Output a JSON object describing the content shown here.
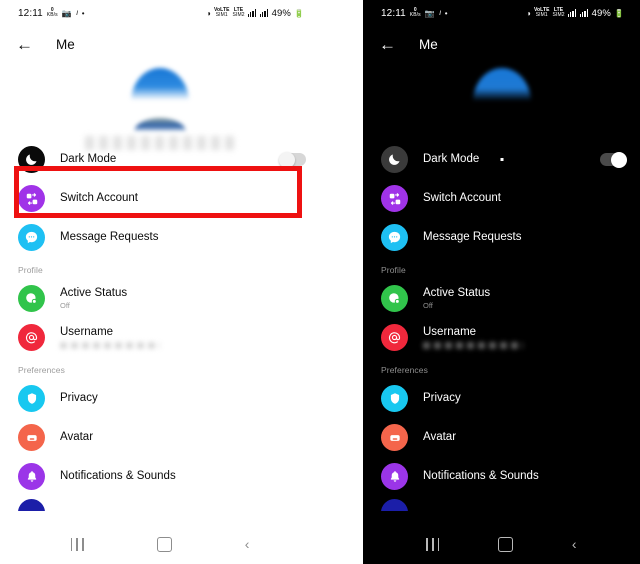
{
  "status_bar": {
    "time": "12:11",
    "left_icons": [
      "data-rate-icon",
      "image-icon",
      "messenger-m-icon",
      "dot-icon"
    ],
    "data_rate_value": "0",
    "data_rate_unit": "KB/s",
    "right_icons": [
      "nfc-icon",
      "volte-sim1-icon",
      "lte-sim2-icon",
      "signal-bars-1-icon",
      "signal-bars-2-icon"
    ],
    "sim1_label": "VoLTE",
    "sim1_sub": "SIM1",
    "sim2_label": "LTE",
    "sim2_sub": "SIM2",
    "battery_percent": "49%",
    "battery_icon": "battery-icon"
  },
  "app_bar": {
    "back_icon": "arrow-left-icon",
    "title": "Me"
  },
  "profile": {
    "avatar_icon": "avatar-blurred",
    "name_blurred": "••••••••••••"
  },
  "colors": {
    "highlight": "#ee1111",
    "dark_mode_icon_light": "#0a0a0a",
    "dark_mode_icon_dark": "#3a3a3a",
    "switch_account": "#a033e8",
    "message_requests": "#1ec0f3",
    "active_status": "#31c44b",
    "username": "#f0283c",
    "privacy": "#18c8f0",
    "avatar": "#f4654b",
    "notifications": "#9b35e8",
    "cutoff_next": "#1b1ea8",
    "light_bg": "#ffffff",
    "dark_bg": "#000000"
  },
  "light_panel": {
    "toggle_state": "off",
    "sections": [
      {
        "label": "",
        "items": [
          {
            "label": "Dark Mode",
            "sub": "",
            "icon": "moon-icon",
            "icon_color": "#0a0a0a",
            "trailing": "toggle"
          },
          {
            "label": "Switch Account",
            "sub": "",
            "icon": "switch-account-icon",
            "icon_color": "#a033e8",
            "trailing": ""
          },
          {
            "label": "Message Requests",
            "sub": "",
            "icon": "message-bubble-icon",
            "icon_color": "#1ec0f3",
            "trailing": ""
          }
        ]
      },
      {
        "label": "Profile",
        "items": [
          {
            "label": "Active Status",
            "sub": "Off",
            "icon": "active-status-icon",
            "icon_color": "#31c44b",
            "trailing": ""
          },
          {
            "label": "Username",
            "sub": "blurred-username",
            "icon": "at-sign-icon",
            "icon_color": "#f0283c",
            "trailing": "",
            "sub_blurred": true
          }
        ]
      },
      {
        "label": "Preferences",
        "items": [
          {
            "label": "Privacy",
            "sub": "",
            "icon": "shield-icon",
            "icon_color": "#18c8f0",
            "trailing": ""
          },
          {
            "label": "Avatar",
            "sub": "",
            "icon": "avatar-icon",
            "icon_color": "#f4654b",
            "trailing": ""
          },
          {
            "label": "Notifications & Sounds",
            "sub": "",
            "icon": "bell-icon",
            "icon_color": "#9b35e8",
            "trailing": ""
          }
        ]
      }
    ]
  },
  "dark_panel": {
    "toggle_state": "on",
    "sections": [
      {
        "label": "",
        "items": [
          {
            "label": "Dark Mode",
            "sub": "",
            "icon": "moon-icon",
            "icon_color": "#3a3a3a",
            "trailing": "toggle"
          },
          {
            "label": "Switch Account",
            "sub": "",
            "icon": "switch-account-icon",
            "icon_color": "#a033e8",
            "trailing": ""
          },
          {
            "label": "Message Requests",
            "sub": "",
            "icon": "message-bubble-icon",
            "icon_color": "#1ec0f3",
            "trailing": ""
          }
        ]
      },
      {
        "label": "Profile",
        "items": [
          {
            "label": "Active Status",
            "sub": "Off",
            "icon": "active-status-icon",
            "icon_color": "#31c44b",
            "trailing": ""
          },
          {
            "label": "Username",
            "sub": "blurred-username",
            "icon": "at-sign-icon",
            "icon_color": "#f0283c",
            "trailing": "",
            "sub_blurred": true
          }
        ]
      },
      {
        "label": "Preferences",
        "items": [
          {
            "label": "Privacy",
            "sub": "",
            "icon": "shield-icon",
            "icon_color": "#18c8f0",
            "trailing": ""
          },
          {
            "label": "Avatar",
            "sub": "",
            "icon": "avatar-icon",
            "icon_color": "#f4654b",
            "trailing": ""
          },
          {
            "label": "Notifications & Sounds",
            "sub": "",
            "icon": "bell-icon",
            "icon_color": "#9b35e8",
            "trailing": ""
          }
        ]
      }
    ]
  },
  "nav_bar": {
    "recent_icon": "recent-apps-icon",
    "home_icon": "home-icon",
    "back_icon": "back-chevron-icon"
  },
  "annotation": {
    "highlight_target": "Dark Mode"
  }
}
